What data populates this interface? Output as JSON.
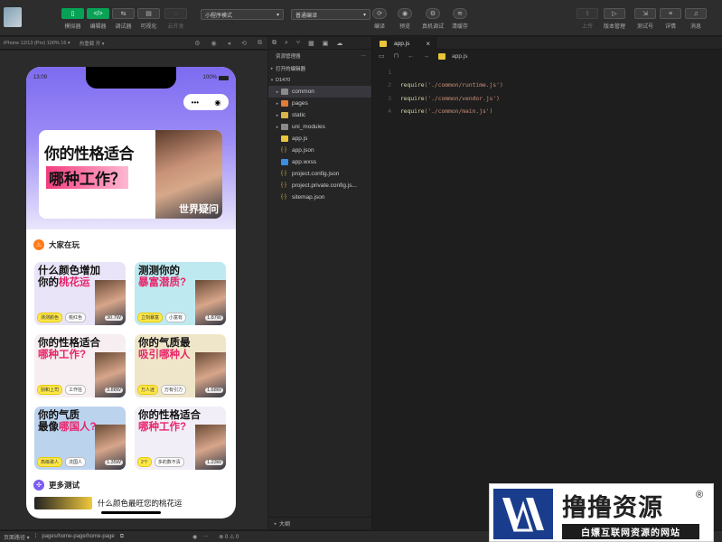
{
  "toolbar": {
    "buttons": [
      {
        "icon": "▯",
        "label": "模拟器"
      },
      {
        "icon": "</>",
        "label": "编辑器"
      },
      {
        "icon": "⇆",
        "label": "调试器"
      },
      {
        "icon": "▤",
        "label": "可视化"
      },
      {
        "icon": "◌",
        "label": "云开发"
      }
    ],
    "mode_select": "小程序模式",
    "compile_select": "普通编译",
    "actions": [
      {
        "icon": "⟳",
        "label": "编译"
      },
      {
        "icon": "◉",
        "label": "预览"
      },
      {
        "icon": "⚙",
        "label": "真机调试"
      },
      {
        "icon": "≋",
        "label": "清缓存"
      }
    ],
    "right_actions": [
      {
        "icon": "⇧",
        "label": "上传"
      },
      {
        "icon": "▷",
        "label": "版本管理"
      },
      {
        "icon": "⇲",
        "label": "测试号"
      },
      {
        "icon": "≡",
        "label": "详情"
      },
      {
        "icon": "♫",
        "label": "消息"
      }
    ]
  },
  "simulator": {
    "device": "iPhone 12/13 (Pro) 100% 16 ▾",
    "hotreload": "热重载 开 ▾",
    "status_time": "13:09",
    "battery": "100%",
    "banner": {
      "line1": "你的性格适合",
      "line2": "哪种工作？",
      "caption": "世界疑问"
    },
    "section_hot": "大家在玩",
    "cards": [
      {
        "title_a": "什么颜色增加",
        "title_b": "你的",
        "title_hl": "桃花运",
        "tags": [
          "测测颜色",
          "桃红色"
        ],
        "count": "30.7W",
        "bg": "#e9e4f7"
      },
      {
        "title_a": "测测你的",
        "title_b": "",
        "title_hl": "暴富潜质?",
        "tags": [
          "立刻暴富",
          "小富有"
        ],
        "count": "1.87W",
        "bg": "#bfe9f0"
      },
      {
        "title_a": "你的性格适合",
        "title_b": "",
        "title_hl": "哪种工作?",
        "tags": [
          "别和上司",
          "工作狂"
        ],
        "count": "3.88W",
        "bg": "#f6eef0"
      },
      {
        "title_a": "你的气质最",
        "title_b": "",
        "title_hl": "吸引哪种人",
        "tags": [
          "万人迷",
          "万有引力"
        ],
        "count": "1.68W",
        "bg": "#efe6c9"
      },
      {
        "title_a": "你的气质",
        "title_b": "最像",
        "title_hl": "哪国人?",
        "tags": [
          "高级歌人",
          "法国人"
        ],
        "count": "1.35W",
        "bg": "#bcd3ee"
      },
      {
        "title_a": "你的性格适合",
        "title_b": "",
        "title_hl": "哪种工作?",
        "tags": [
          "2个",
          "多的数不清"
        ],
        "count": "1.23W",
        "bg": "#f2eef8"
      }
    ],
    "section_more": "更多测试",
    "more_item": "什么颜色最旺您的桃花运"
  },
  "explorer": {
    "header": "资源管理器",
    "menu": "···",
    "open_editors": "打开的编辑器",
    "project": "D1470",
    "items": [
      {
        "name": "common",
        "type": "folder",
        "arrow": "▸",
        "selected": true
      },
      {
        "name": "pages",
        "type": "folder-o",
        "arrow": "▸",
        "selected": false
      },
      {
        "name": "static",
        "type": "folder-y",
        "arrow": "▸",
        "selected": false
      },
      {
        "name": "uni_modules",
        "type": "folder",
        "arrow": "▸",
        "selected": false
      },
      {
        "name": "app.js",
        "type": "js",
        "arrow": "",
        "selected": false
      },
      {
        "name": "app.json",
        "type": "json",
        "arrow": "",
        "selected": false
      },
      {
        "name": "app.wxss",
        "type": "css",
        "arrow": "",
        "selected": false
      },
      {
        "name": "project.config.json",
        "type": "json",
        "arrow": "",
        "selected": false
      },
      {
        "name": "project.private.config.js...",
        "type": "json",
        "arrow": "",
        "selected": false
      },
      {
        "name": "sitemap.json",
        "type": "json",
        "arrow": "",
        "selected": false
      }
    ],
    "outline": "大纲"
  },
  "editor": {
    "tab": "app.js",
    "breadcrumb_file": "app.js",
    "lines": [
      {
        "n": "1",
        "req": "",
        "str": ""
      },
      {
        "n": "2",
        "req": "require",
        "str": "('./common/runtime.js')"
      },
      {
        "n": "3",
        "req": "require",
        "str": "('./common/vendor.js')"
      },
      {
        "n": "4",
        "req": "require",
        "str": "('./common/main.js')"
      }
    ]
  },
  "statusbar": {
    "path_label": "页面路径 ▾",
    "path": "pages/home-page/home-page",
    "errors": "⊗ 0 ⚠ 0"
  },
  "watermark": {
    "title": "撸撸资源",
    "reg": "®",
    "subtitle": "白嫖互联网资源的网站"
  }
}
